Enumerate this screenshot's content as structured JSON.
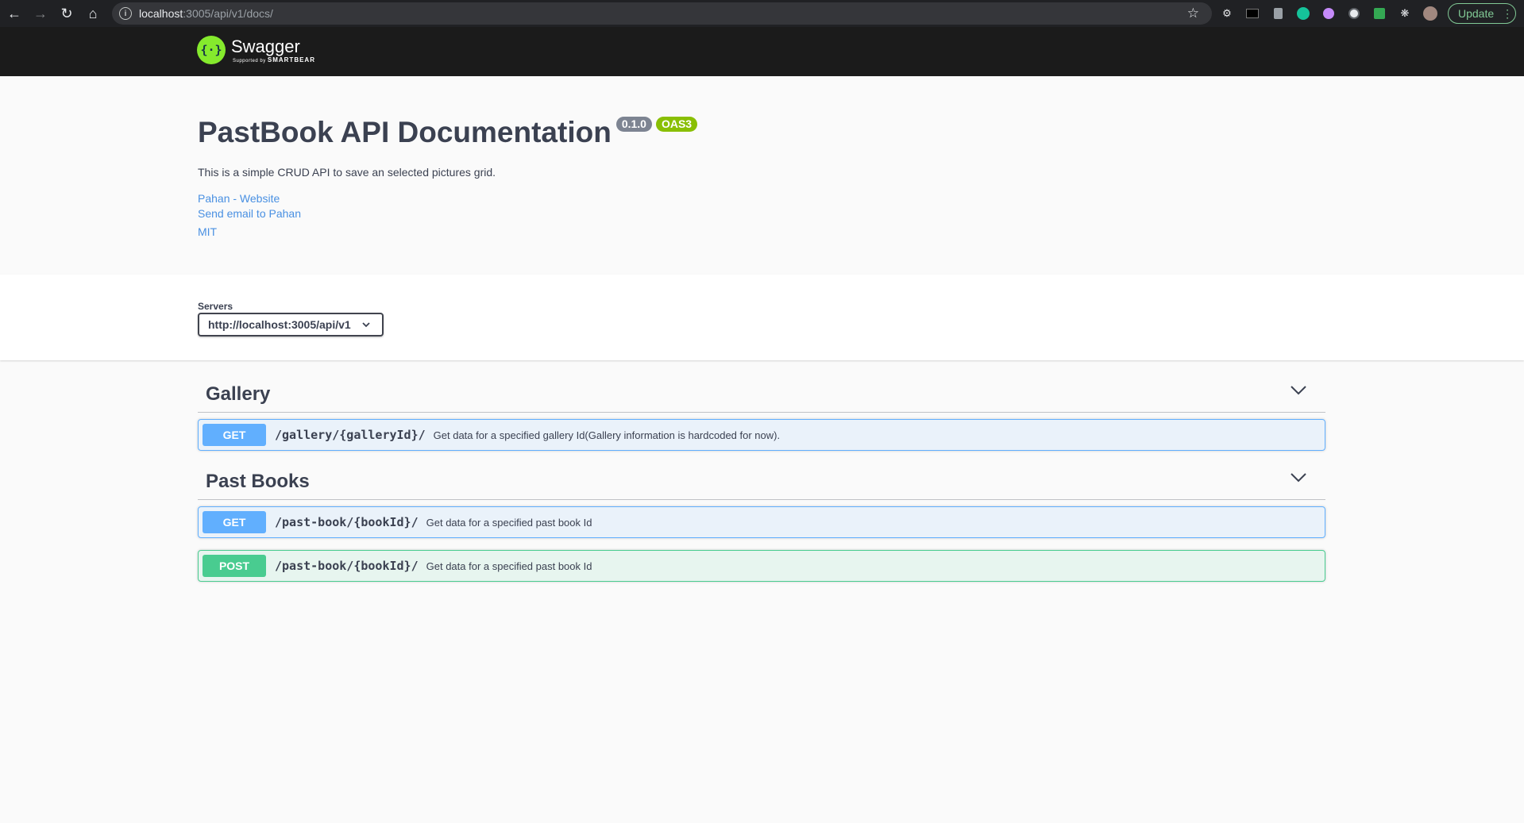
{
  "browser": {
    "url_host": "localhost",
    "url_rest": ":3005/api/v1/docs/",
    "update_label": "Update"
  },
  "topbar": {
    "logo_name": "Swagger",
    "logo_sub_prefix": "Supported by",
    "logo_sub_brand": "SMARTBEAR"
  },
  "info": {
    "title": "PastBook API Documentation",
    "version": "0.1.0",
    "oas": "OAS3",
    "description": "This is a simple CRUD API to save an selected pictures grid.",
    "links": {
      "website": "Pahan - Website",
      "email": "Send email to Pahan",
      "license": "MIT"
    }
  },
  "servers": {
    "label": "Servers",
    "selected": "http://localhost:3005/api/v1"
  },
  "tags": [
    {
      "name": "Gallery",
      "operations": [
        {
          "method": "GET",
          "path": "/gallery/{galleryId}/",
          "summary": "Get data for a specified gallery Id(Gallery information is hardcoded for now)."
        }
      ]
    },
    {
      "name": "Past Books",
      "operations": [
        {
          "method": "GET",
          "path": "/past-book/{bookId}/",
          "summary": "Get data for a specified past book Id"
        },
        {
          "method": "POST",
          "path": "/past-book/{bookId}/",
          "summary": "Get data for a specified past book Id"
        }
      ]
    }
  ],
  "colors": {
    "get": "#61affe",
    "post": "#49cc90",
    "link": "#4990e2",
    "topbar": "#1b1b1b",
    "logo": "#85ea2d"
  }
}
